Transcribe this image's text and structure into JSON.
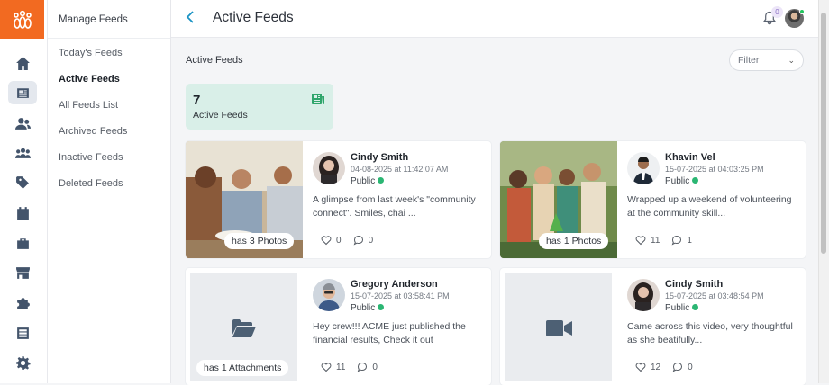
{
  "app": {
    "logo_icon": "lotus-people-logo-icon",
    "accent": "#f26a21"
  },
  "iconbar": {
    "items": [
      "home-icon",
      "newspaper-icon",
      "users-icon",
      "group-icon",
      "tag-icon",
      "calendar-icon",
      "briefcase-icon",
      "store-icon",
      "puzzle-icon",
      "list-icon",
      "gear-icon"
    ]
  },
  "menu": {
    "title": "Manage Feeds",
    "items": [
      {
        "label": "Today's Feeds"
      },
      {
        "label": "Active Feeds"
      },
      {
        "label": "All Feeds List"
      },
      {
        "label": "Archived Feeds"
      },
      {
        "label": "Inactive Feeds"
      },
      {
        "label": "Deleted Feeds"
      }
    ]
  },
  "header": {
    "back_icon": "chevron-left-icon",
    "title": "Active Feeds",
    "notifications": "0"
  },
  "section": {
    "label": "Active Feeds",
    "filter_placeholder": "Filter"
  },
  "stat": {
    "count": "7",
    "label": "Active Feeds",
    "icon": "newspaper-icon"
  },
  "feeds": [
    {
      "media_label": "has 3 Photos",
      "name": "Cindy Smith",
      "date": "04-08-2025 at 11:42:07 AM",
      "visibility": "Public",
      "text": "A glimpse from last week's \"community connect\". Smiles, chai ...",
      "likes": "0",
      "comments": "0"
    },
    {
      "media_label": "has 1 Photos",
      "name": "Khavin Vel",
      "date": "15-07-2025 at 04:03:25 PM",
      "visibility": "Public",
      "text": "Wrapped up a weekend of volunteering at the community skill...",
      "likes": "11",
      "comments": "1"
    },
    {
      "media_label": "has 1 Attachments",
      "name": "Gregory Anderson",
      "date": "15-07-2025 at 03:58:41 PM",
      "visibility": "Public",
      "text": "Hey crew!!! ACME just published the financial results, Check it out",
      "likes": "11",
      "comments": "0"
    },
    {
      "media_label": "",
      "name": "Cindy Smith",
      "date": "15-07-2025 at 03:48:54 PM",
      "visibility": "Public",
      "text": "Came across this video, very thoughtful as she beatifully...",
      "likes": "12",
      "comments": "0"
    }
  ]
}
